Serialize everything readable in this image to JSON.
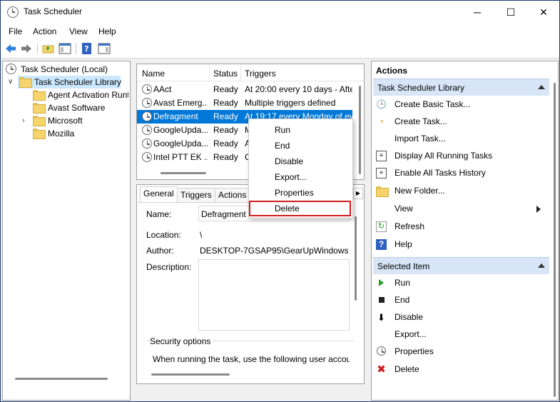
{
  "window": {
    "title": "Task Scheduler"
  },
  "menu": [
    "File",
    "Action",
    "View",
    "Help"
  ],
  "tree": {
    "root": "Task Scheduler (Local)",
    "library": "Task Scheduler Library",
    "folders": [
      "Agent Activation Runt",
      "Avast Software",
      "Microsoft",
      "Mozilla"
    ]
  },
  "tasks": {
    "columns": [
      "Name",
      "Status",
      "Triggers"
    ],
    "rows": [
      {
        "name": "AAct",
        "status": "Ready",
        "trigger": "At 20:00 every 10 days - After"
      },
      {
        "name": "Avast Emerg...",
        "status": "Ready",
        "trigger": "Multiple triggers defined"
      },
      {
        "name": "Defragment",
        "status": "Ready",
        "trigger": "At 19:17 every Monday of ev"
      },
      {
        "name": "GoogleUpda...",
        "status": "Ready",
        "trigger": "M"
      },
      {
        "name": "GoogleUpda...",
        "status": "Ready",
        "trigger": "A"
      },
      {
        "name": "Intel PTT EK ...",
        "status": "Ready",
        "trigger": "C"
      }
    ]
  },
  "context_menu": [
    "Run",
    "End",
    "Disable",
    "Export...",
    "Properties",
    "Delete"
  ],
  "details": {
    "tabs": [
      "General",
      "Triggers",
      "Actions"
    ],
    "name_label": "Name:",
    "name_value": "Defragment",
    "location_label": "Location:",
    "location_value": "\\",
    "author_label": "Author:",
    "author_value": "DESKTOP-7GSAP95\\GearUpWindows",
    "description_label": "Description:",
    "security_title": "Security options",
    "security_text": "When running the task, use the following user accou"
  },
  "actions": {
    "title": "Actions",
    "section1": "Task Scheduler Library",
    "items1": [
      "Create Basic Task...",
      "Create Task...",
      "Import Task...",
      "Display All Running Tasks",
      "Enable All Tasks History",
      "New Folder...",
      "View",
      "Refresh",
      "Help"
    ],
    "section2": "Selected Item",
    "items2": [
      "Run",
      "End",
      "Disable",
      "Export...",
      "Properties",
      "Delete"
    ]
  },
  "colors": {
    "accent": "#0078d7",
    "highlight_border": "#d11a1a",
    "section_bg": "#d7e5f6"
  }
}
